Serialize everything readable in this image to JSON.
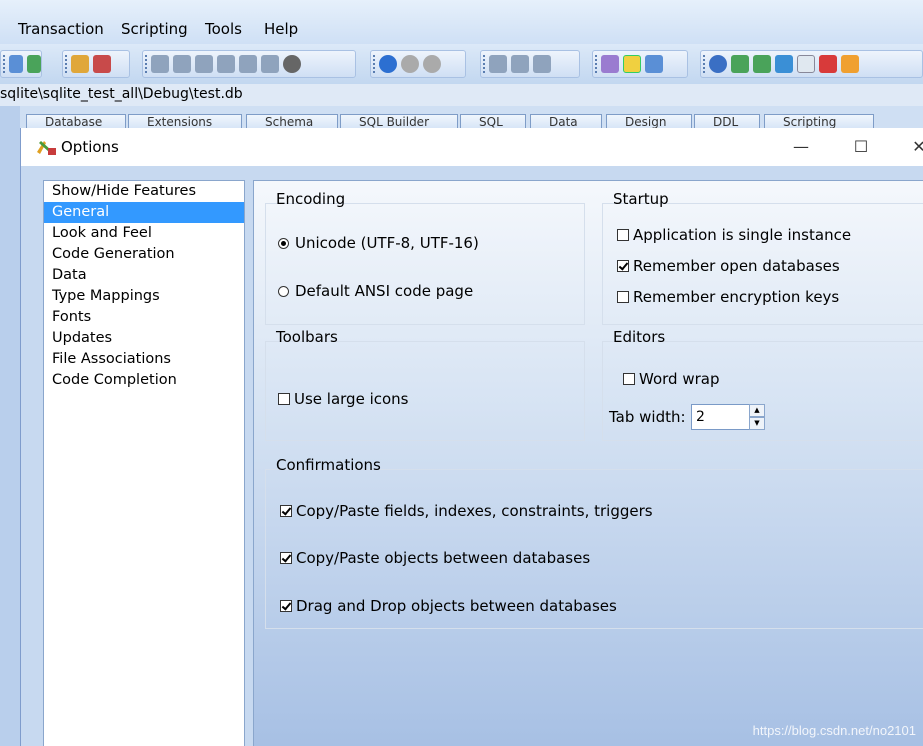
{
  "menu": {
    "items": [
      "Transaction",
      "Scripting",
      "Tools",
      "Help"
    ]
  },
  "path_bar": {
    "text": "sqlite\\sqlite_test_all\\Debug\\test.db"
  },
  "app_tabs": [
    "Database",
    "Extensions",
    "Schema",
    "SQL Builder",
    "SQL",
    "Data",
    "Design",
    "DDL",
    "Scripting"
  ],
  "dialog": {
    "title": "Options",
    "minimize_glyph": "—",
    "maximize_glyph": "☐",
    "close_glyph": "✕"
  },
  "nav": {
    "items": [
      "Show/Hide Features",
      "General",
      "Look and Feel",
      "Code Generation",
      "Data",
      "Type Mappings",
      "Fonts",
      "Updates",
      "File Associations",
      "Code Completion"
    ],
    "selected": "General"
  },
  "encoding": {
    "title": "Encoding",
    "unicode_label": "Unicode (UTF-8, UTF-16)",
    "unicode_selected": true,
    "ansi_label": "Default ANSI code page",
    "ansi_selected": false
  },
  "startup": {
    "title": "Startup",
    "single_instance_label": "Application is single instance",
    "single_instance_checked": false,
    "remember_db_label": "Remember open databases",
    "remember_db_checked": true,
    "remember_keys_label": "Remember encryption keys",
    "remember_keys_checked": false
  },
  "toolbars": {
    "title": "Toolbars",
    "large_icons_label": "Use large icons",
    "large_icons_checked": false
  },
  "editors": {
    "title": "Editors",
    "word_wrap_label": "Word wrap",
    "word_wrap_checked": false,
    "tab_width_label": "Tab width:",
    "tab_width_value": "2"
  },
  "confirmations": {
    "title": "Confirmations",
    "copy_fields_label": "Copy/Paste fields, indexes, constraints, triggers",
    "copy_fields_checked": true,
    "copy_objects_label": "Copy/Paste objects between databases",
    "copy_objects_checked": true,
    "drag_drop_label": "Drag and Drop objects between databases",
    "drag_drop_checked": true
  },
  "watermark": "https://blog.csdn.net/no2101",
  "colors": {
    "selection": "#3399ff",
    "panel_gradient_top": "#f5f8fc",
    "panel_gradient_bottom": "#a7c0e4"
  }
}
